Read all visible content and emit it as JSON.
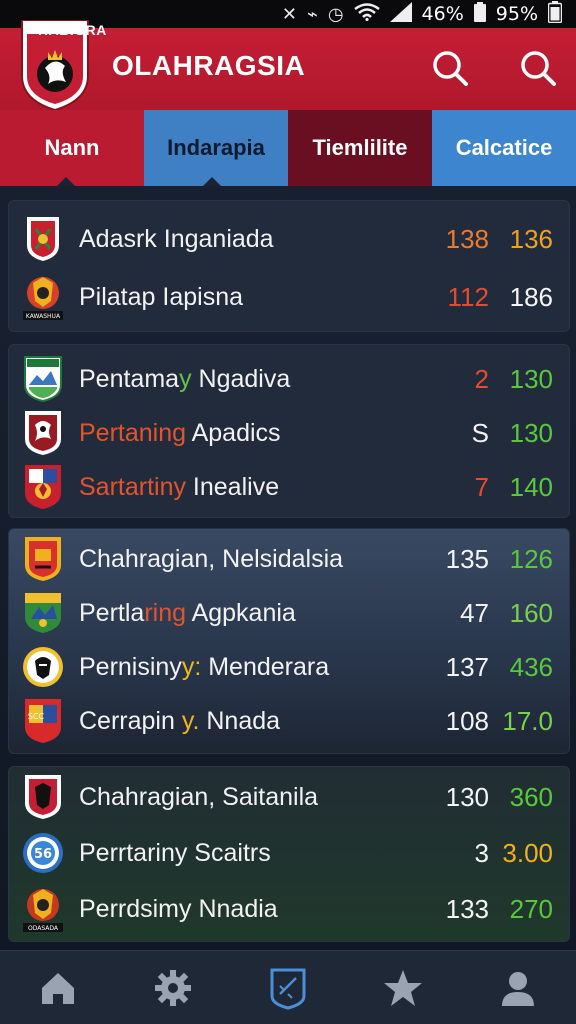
{
  "status_bar": {
    "battery_left": "46%",
    "battery_right": "95%"
  },
  "header": {
    "logo_text": "HABIGRA",
    "title": "OLAHRAGSIA"
  },
  "tabs": [
    {
      "label": "Nann"
    },
    {
      "label": "Indarapia"
    },
    {
      "label": "Tiemlilite"
    },
    {
      "label": "Calcatice"
    }
  ],
  "groups": [
    {
      "rows": [
        {
          "name_a": "Adasrk Inganiada",
          "v1": "138",
          "v2": "136"
        },
        {
          "name_a": "Pilatap Iapisna",
          "v1": "112",
          "v2": "186"
        }
      ]
    },
    {
      "rows": [
        {
          "name_a": "Pentama",
          "name_b": "y",
          "name_c": " Ngadiva",
          "v1": "2",
          "v2": "130"
        },
        {
          "name_a": "Pertaning",
          "name_c": " Apadics",
          "v1": "S",
          "v2": "130"
        },
        {
          "name_a": "Sartartiny",
          "name_c": " Inealive",
          "v1": "7",
          "v2": "140"
        }
      ]
    },
    {
      "rows": [
        {
          "name_a": "Chahragian, Nelsidalsia",
          "v1": "135",
          "v2": "126"
        },
        {
          "name_a": "Pertla",
          "name_b": "ring",
          "name_c": " Agpkania",
          "v1": "47",
          "v2": "160"
        },
        {
          "name_a": "Pernisiny",
          "name_b": "y:",
          "name_c": " Menderara",
          "v1": "137",
          "v2": "436"
        },
        {
          "name_a": "Cerrapin",
          "name_b": " y.",
          "name_c": " Nnada",
          "v1": "108",
          "v2": "17.0"
        }
      ]
    },
    {
      "rows": [
        {
          "name_a": "Chahragian, Saitanila",
          "v1": "130",
          "v2": "360"
        },
        {
          "name_a": "Perrtariny Scaitrs",
          "v1": "3",
          "v2": "3.00"
        },
        {
          "name_a": "Perrdsimy Nnadia",
          "v1": "133",
          "v2": "270"
        }
      ]
    }
  ],
  "badge_text": {
    "kawasaki": "KAWASHUA",
    "odasa": "ODASADA",
    "scc": "SCC"
  },
  "bottom_nav": [
    {
      "icon": "home-icon"
    },
    {
      "icon": "gear-icon"
    },
    {
      "icon": "tactics-icon"
    },
    {
      "icon": "star-icon"
    },
    {
      "icon": "profile-icon"
    }
  ]
}
